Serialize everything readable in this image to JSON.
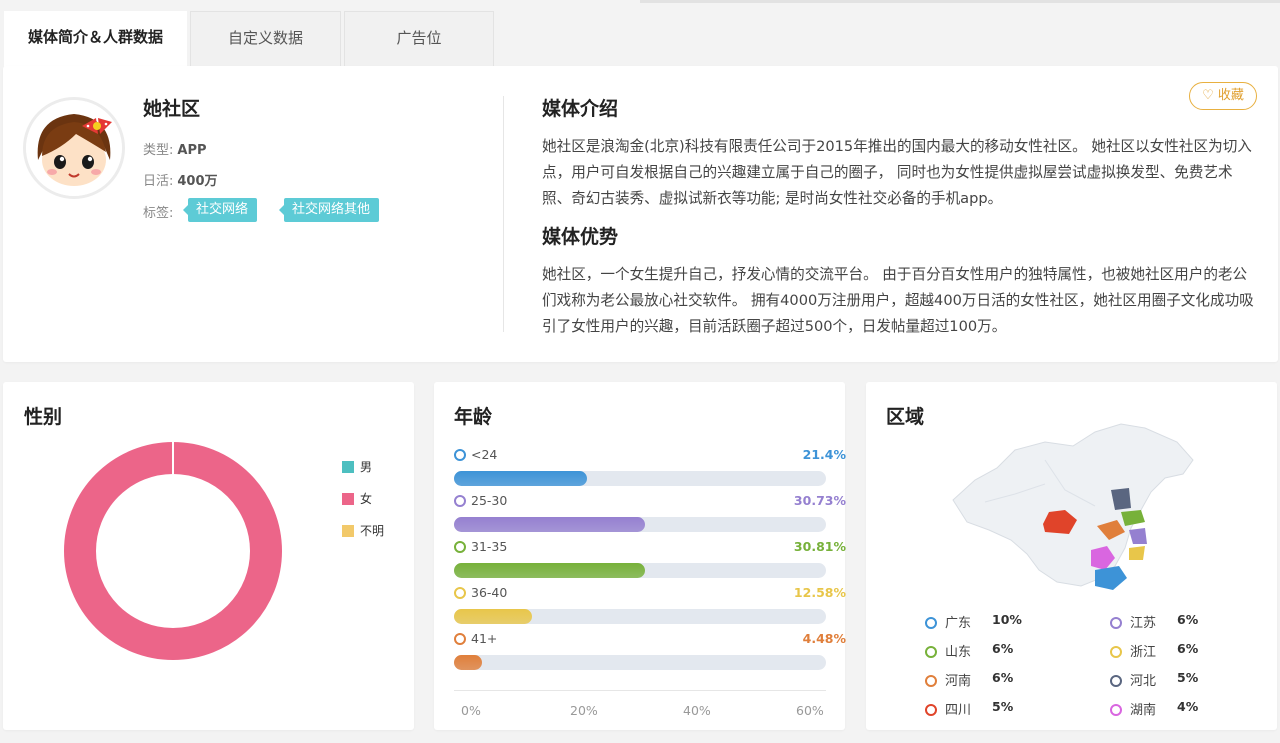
{
  "tabs": [
    {
      "label": "媒体简介＆人群数据",
      "active": true
    },
    {
      "label": "自定义数据",
      "active": false
    },
    {
      "label": "广告位",
      "active": false
    }
  ],
  "profile": {
    "name": "她社区",
    "type_label": "类型:",
    "type_value": "APP",
    "dau_label": "日活:",
    "dau_value": "400万",
    "tags_label": "标签:",
    "tags": [
      "社交网络",
      "社交网络其他"
    ],
    "favorite_label": "收藏"
  },
  "intro": {
    "title": "媒体介绍",
    "text": "她社区是浪淘金(北京)科技有限责任公司于2015年推出的国内最大的移动女性社区。 她社区以女性社区为切入点，用户可自发根据自己的兴趣建立属于自己的圈子， 同时也为女性提供虚拟屋尝试虚拟换发型、免费艺术照、奇幻古装秀、虚拟试新衣等功能; 是时尚女性社交必备的手机app。"
  },
  "advantage": {
    "title": "媒体优势",
    "text": "她社区，一个女生提升自己，抒发心情的交流平台。 由于百分百女性用户的独特属性，也被她社区用户的老公们戏称为老公最放心社交软件。 拥有4000万注册用户，超越400万日活的女性社区，她社区用圈子文化成功吸引了女性用户的兴趣，目前活跃圈子超过500个，日发帖量超过100万。"
  },
  "gender": {
    "title": "性别",
    "legend": [
      {
        "label": "男",
        "color": "#4dbfc0"
      },
      {
        "label": "女",
        "color": "#ec6589"
      },
      {
        "label": "不明",
        "color": "#f2c96a"
      }
    ],
    "chart_data": {
      "type": "pie",
      "categories": [
        "男",
        "女",
        "不明"
      ],
      "values": [
        0,
        100,
        0
      ]
    }
  },
  "age": {
    "title": "年龄",
    "chart_data": {
      "type": "bar",
      "categories": [
        "<24",
        "25-30",
        "31-35",
        "36-40",
        "41+"
      ],
      "values": [
        21.4,
        30.73,
        30.81,
        12.58,
        4.48
      ],
      "value_labels": [
        "21.4%",
        "30.73%",
        "30.81%",
        "12.58%",
        "4.48%"
      ],
      "colors": [
        "#3d93d7",
        "#9580d0",
        "#77b13a",
        "#e8c64a",
        "#e07f3b"
      ],
      "xlim": [
        0,
        60
      ],
      "xticks": [
        "0%",
        "20%",
        "40%",
        "60%"
      ]
    }
  },
  "region": {
    "title": "区域",
    "items": [
      {
        "name": "广东",
        "pct": "10%",
        "color": "#3d93d7"
      },
      {
        "name": "江苏",
        "pct": "6%",
        "color": "#9580d0"
      },
      {
        "name": "山东",
        "pct": "6%",
        "color": "#77b13a"
      },
      {
        "name": "浙江",
        "pct": "6%",
        "color": "#e8c64a"
      },
      {
        "name": "河南",
        "pct": "6%",
        "color": "#e07f3b"
      },
      {
        "name": "河北",
        "pct": "5%",
        "color": "#5a6680"
      },
      {
        "name": "四川",
        "pct": "5%",
        "color": "#e0442a"
      },
      {
        "name": "湖南",
        "pct": "4%",
        "color": "#d966e0"
      }
    ]
  }
}
